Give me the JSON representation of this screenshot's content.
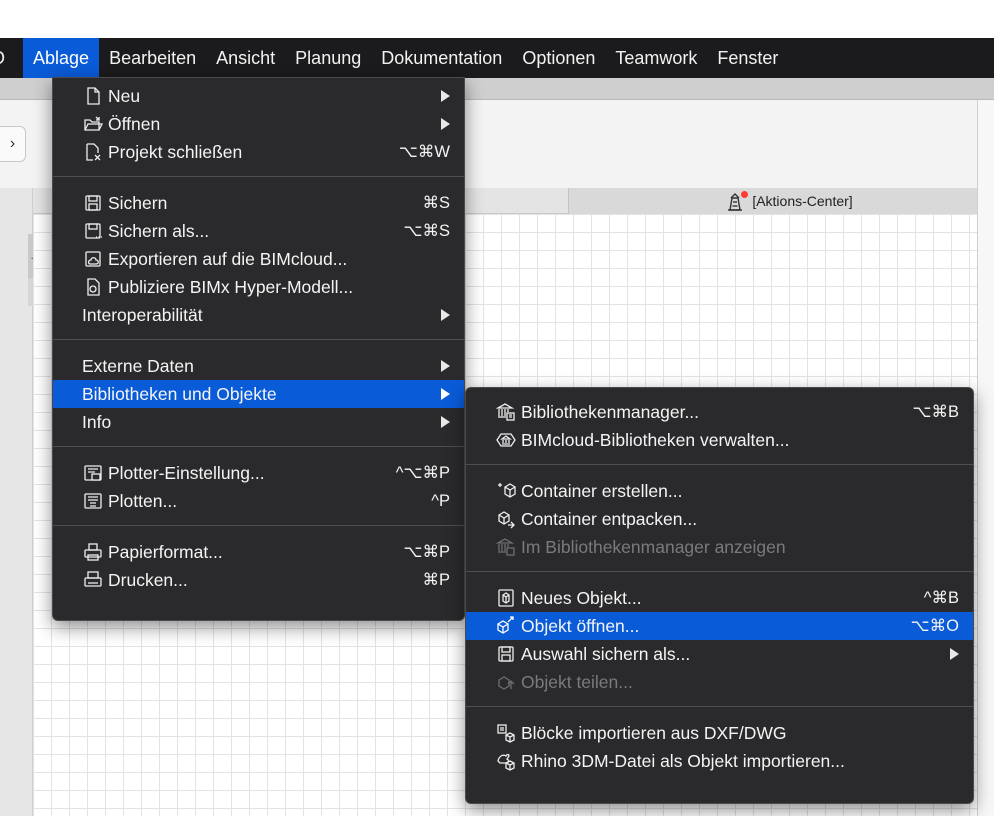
{
  "menubar": {
    "items": [
      "D",
      "Ablage",
      "Bearbeiten",
      "Ansicht",
      "Planung",
      "Dokumentation",
      "Optionen",
      "Teamwork",
      "Fenster"
    ]
  },
  "sidebar": {
    "toggle_glyph": "›",
    "dots": "…"
  },
  "tabbar": {
    "tab_label": "[Aktions-Center]"
  },
  "ablage_menu": {
    "neu": "Neu",
    "oeffnen": "Öffnen",
    "projekt_schliessen": "Projekt schließen",
    "projekt_schliessen_sc": "⌥⌘W",
    "sichern": "Sichern",
    "sichern_sc": "⌘S",
    "sichern_als": "Sichern als...",
    "sichern_als_sc": "⌥⌘S",
    "exportieren": "Exportieren auf die BIMcloud...",
    "publiziere": "Publiziere BIMx Hyper-Modell...",
    "interoperabilitaet": "Interoperabilität",
    "externe_daten": "Externe Daten",
    "bibliotheken": "Bibliotheken und Objekte",
    "info": "Info",
    "plotter_einstellung": "Plotter-Einstellung...",
    "plotter_einstellung_sc": "^⌥⌘P",
    "plotten": "Plotten...",
    "plotten_sc": "^P",
    "papierformat": "Papierformat...",
    "papierformat_sc": "⌥⌘P",
    "drucken": "Drucken...",
    "drucken_sc": "⌘P"
  },
  "bibliotheken_menu": {
    "bibliothekenmanager": "Bibliothekenmanager...",
    "bibliothekenmanager_sc": "⌥⌘B",
    "bimcloud_bibliotheken": "BIMcloud-Bibliotheken verwalten...",
    "container_erstellen": "Container erstellen...",
    "container_entpacken": "Container entpacken...",
    "im_bibliothekenmanager": "Im Bibliothekenmanager anzeigen",
    "neues_objekt": "Neues Objekt...",
    "neues_objekt_sc": "^⌘B",
    "objekt_oeffnen": "Objekt öffnen...",
    "objekt_oeffnen_sc": "⌥⌘O",
    "auswahl_sichern": "Auswahl sichern als...",
    "objekt_teilen": "Objekt teilen...",
    "bloecke_importieren": "Blöcke importieren aus DXF/DWG",
    "rhino_importieren": "Rhino 3DM-Datei als Objekt importieren..."
  },
  "colors": {
    "menubar_bg": "#1b1b1d",
    "menu_bg": "#2a2a2c",
    "highlight": "#0a5bd8",
    "notification_dot": "#ff3b30"
  }
}
